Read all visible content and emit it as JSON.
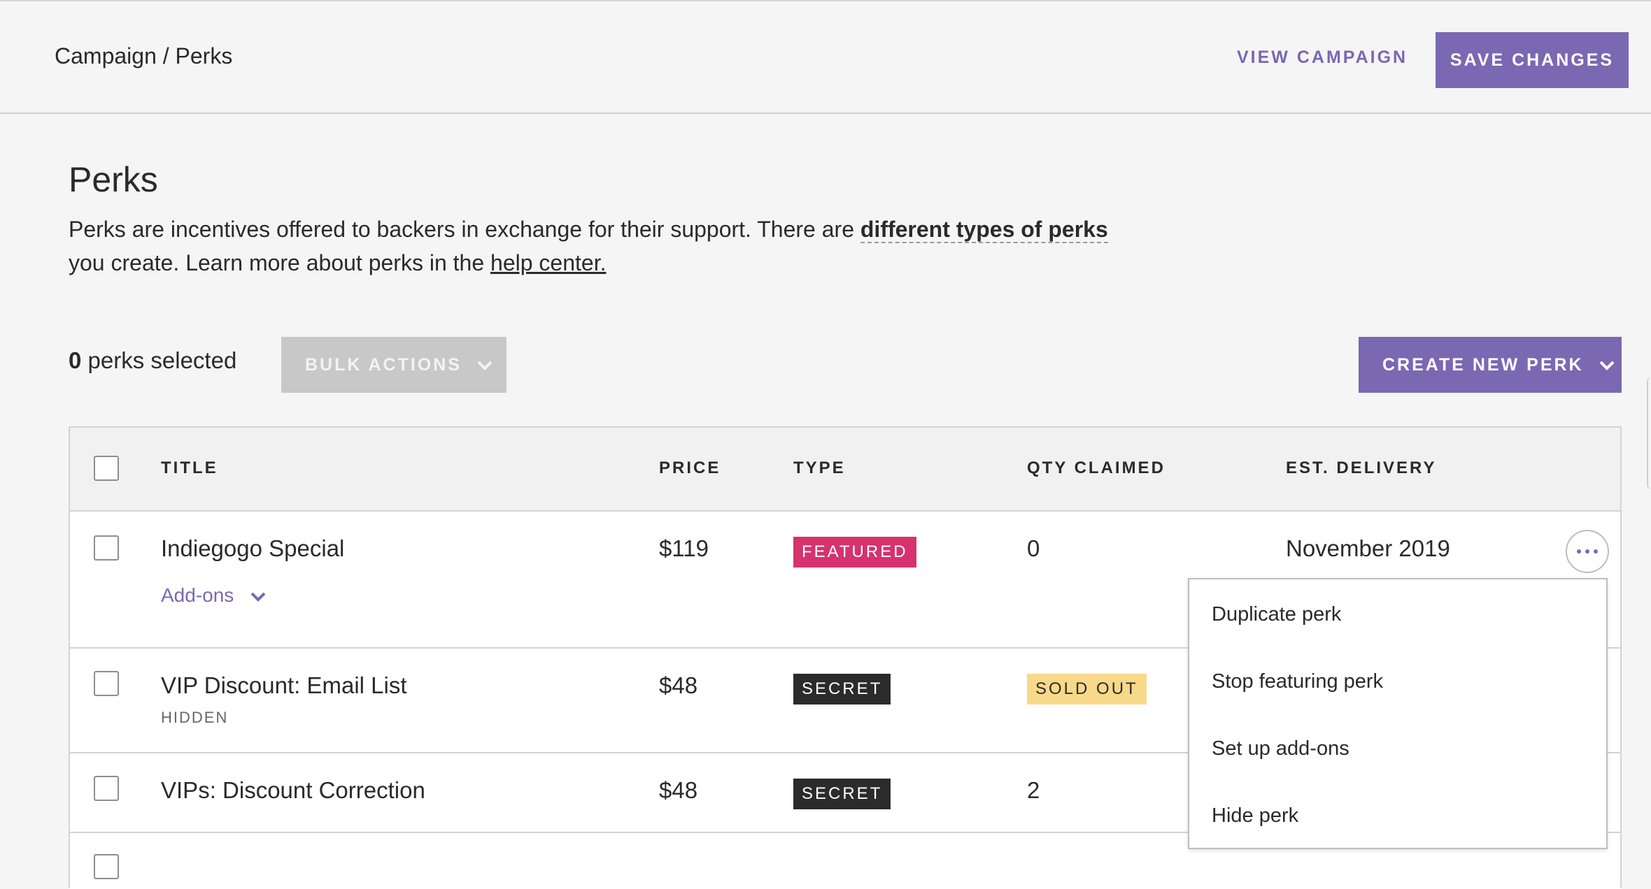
{
  "header": {
    "breadcrumb": "Campaign / Perks",
    "view_campaign": "VIEW CAMPAIGN",
    "save_changes": "SAVE CHANGES"
  },
  "intro": {
    "title": "Perks",
    "text_1": "Perks are incentives offered to backers in exchange for their support. There are ",
    "link_types": "different types of perks",
    "text_2": " you create. Learn more about perks in the ",
    "link_help": "help center."
  },
  "toolbar": {
    "selected_count": "0",
    "selected_label": " perks selected",
    "bulk_actions": "BULK ACTIONS",
    "create_new_perk": "CREATE NEW PERK"
  },
  "table": {
    "columns": [
      "TITLE",
      "PRICE",
      "TYPE",
      "QTY CLAIMED",
      "EST. DELIVERY"
    ],
    "rows": [
      {
        "title": "Indiegogo Special",
        "addons": "Add-ons",
        "price": "$119",
        "type": "FEATURED",
        "qty": "0",
        "delivery": "November 2019"
      },
      {
        "title": "VIP Discount: Email List",
        "sub": "HIDDEN",
        "price": "$48",
        "type": "SECRET",
        "qty": "SOLD OUT"
      },
      {
        "title": "VIPs: Discount Correction",
        "price": "$48",
        "type": "SECRET",
        "qty": "2"
      }
    ]
  },
  "menu": {
    "items": [
      "Duplicate perk",
      "Stop featuring perk",
      "Set up add-ons",
      "Hide perk"
    ]
  },
  "colors": {
    "accent": "#7a68b2",
    "featured": "#d6326e",
    "secret": "#2b2b2b",
    "soldout": "#f8d98a"
  }
}
